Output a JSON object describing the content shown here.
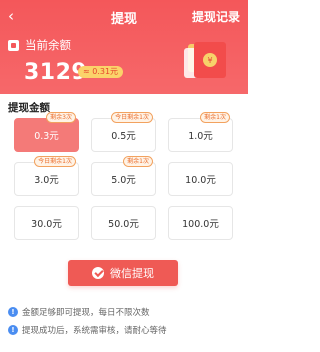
{
  "header": {
    "title": "提现",
    "record_label": "提现记录",
    "balance_label": "当前余额",
    "balance_value": "3129",
    "balance_badge": "≈ 0.31元",
    "colors": {
      "primary": "#f4575a"
    }
  },
  "section": {
    "title": "提现金额"
  },
  "options": [
    {
      "amount": "0.3元",
      "tag": "剩余3次",
      "selected": true
    },
    {
      "amount": "0.5元",
      "tag": "今日剩余1次"
    },
    {
      "amount": "1.0元",
      "tag": "剩余1次"
    },
    {
      "amount": "3.0元",
      "tag": "今日剩余1次"
    },
    {
      "amount": "5.0元",
      "tag": "剩余1次"
    },
    {
      "amount": "10.0元",
      "tag": ""
    },
    {
      "amount": "30.0元",
      "tag": ""
    },
    {
      "amount": "50.0元",
      "tag": ""
    },
    {
      "amount": "100.0元",
      "tag": ""
    }
  ],
  "button": {
    "label": "微信提现",
    "icon": "wechat-icon"
  },
  "notes": [
    "金额足够即可提现，每日不限次数",
    "提现成功后，系统需审核，请耐心等待"
  ]
}
